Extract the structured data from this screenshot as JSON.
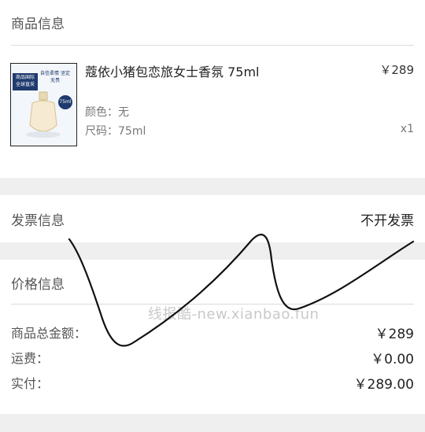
{
  "product_section": {
    "title": "商品信息",
    "product": {
      "name": "蔻依小猪包恋旅女士香氛 75ml",
      "price": "￥289",
      "color_label": "颜色：",
      "color_value": "无",
      "size_label": "尺码：",
      "size_value": "75ml",
      "quantity": "x1",
      "thumb": {
        "badge": "商品国际 全球直采",
        "tagline": "自信柔情 坚定无畏",
        "size_tag": "75ml"
      }
    }
  },
  "invoice_section": {
    "title": "发票信息",
    "value": "不开发票"
  },
  "price_section": {
    "title": "价格信息",
    "rows": [
      {
        "label": "商品总金额：",
        "value": "￥289"
      },
      {
        "label": "运费：",
        "value": "￥0.00"
      },
      {
        "label": "实付：",
        "value": "￥289.00"
      }
    ]
  },
  "watermark": "线报酷-new.xianbao.fun"
}
